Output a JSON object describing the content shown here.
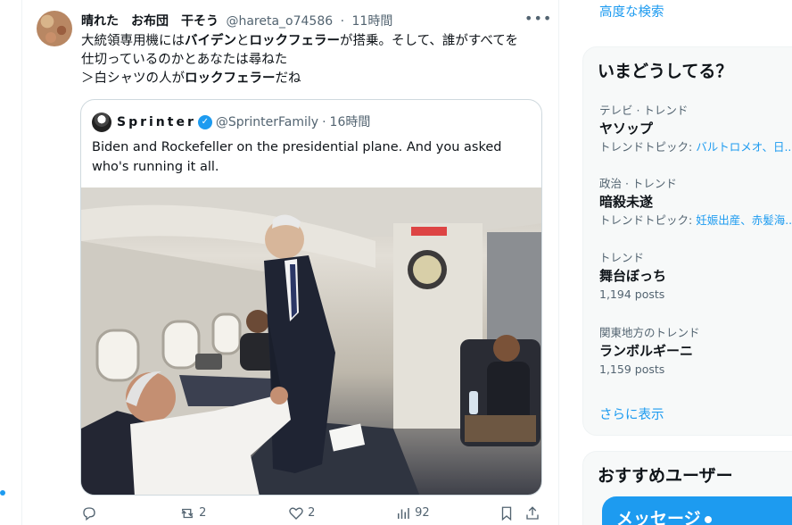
{
  "tweet": {
    "author_name": "晴れた　お布団　干そう",
    "handle": "@hareta_o74586",
    "time": "11時間",
    "text_parts": {
      "l1a": "大統領専用機には",
      "l1b": "バイデン",
      "l1c": "と",
      "l1d": "ロックフェラー",
      "l1e": "が搭乗。そして、誰がすべてを",
      "l2": "仕切っているのかとあなたは尋ねた",
      "l3a": "＞白シャツの人が",
      "l3b": "ロックフェラー",
      "l3c": "だね"
    },
    "quote": {
      "author_name": "Sprinter",
      "handle": "@SprinterFamily",
      "time": "16時間",
      "text": "Biden and Rockefeller on the presidential plane. And you asked who's running it all."
    },
    "actions": {
      "retweets": "2",
      "likes": "2",
      "views": "92"
    }
  },
  "sidebar": {
    "top_link": "高度な検索",
    "trends_title": "いまどうしてる？",
    "trends": [
      {
        "meta": "テレビ · トレンド",
        "title": "ヤソップ",
        "sub_prefix": "トレンドトピック: ",
        "sub_links": "バルトロメオ、日..."
      },
      {
        "meta": "政治 · トレンド",
        "title": "暗殺未遂",
        "sub_prefix": "トレンドトピック: ",
        "sub_links": "妊娠出産、赤髪海..."
      },
      {
        "meta": "トレンド",
        "title": "舞台ぼっち",
        "posts": "1,194 posts"
      },
      {
        "meta": "関東地方のトレンド",
        "title": "ランボルギーニ",
        "posts": "1,159 posts"
      }
    ],
    "show_more": "さらに表示",
    "users_title": "おすすめユーザー",
    "messages_label": "メッセージ"
  },
  "colors": {
    "accent": "#1d9bf0",
    "text": "#0f1419",
    "muted": "#536471"
  }
}
